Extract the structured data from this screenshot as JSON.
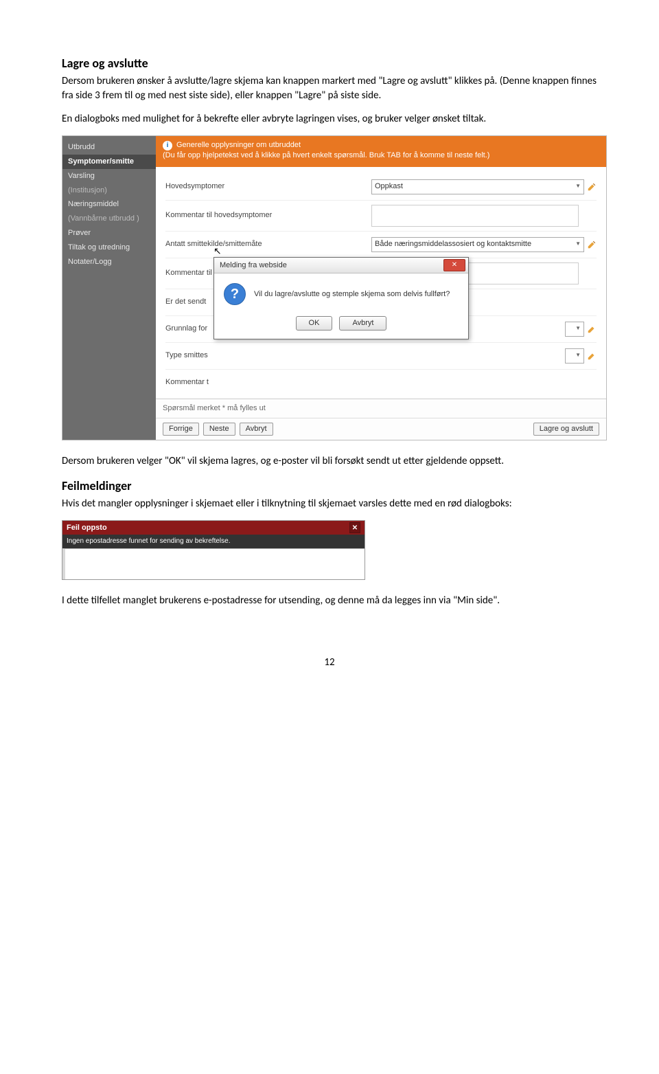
{
  "doc": {
    "h1": "Lagre og avslutte",
    "p1": "Dersom brukeren ønsker å avslutte/lagre skjema kan knappen markert med \"Lagre og avslutt\" klikkes på. (Denne knappen finnes fra side 3 frem til og med nest siste side), eller knappen \"Lagre\" på siste side.",
    "p2": "En dialogboks med mulighet for å bekrefte eller avbryte lagringen vises, og bruker velger ønsket tiltak.",
    "p3": "Dersom brukeren velger \"OK\" vil skjema lagres, og e-poster vil bli forsøkt sendt ut etter gjeldende oppsett.",
    "h2": "Feilmeldinger",
    "p4": "Hvis det mangler opplysninger i skjemaet eller i tilknytning til skjemaet varsles dette med en rød dialogboks:",
    "p5": "I dette tilfellet manglet brukerens e-postadresse for utsending, og denne må da legges inn via \"Min side\".",
    "pagenum": "12"
  },
  "ui": {
    "sidebar": {
      "items": [
        {
          "label": "Utbrudd"
        },
        {
          "label": "Symptomer/smitte",
          "sel": true
        },
        {
          "label": "Varsling"
        },
        {
          "label": "(Institusjon)",
          "dim": true
        },
        {
          "label": "Næringsmiddel"
        },
        {
          "label": "(Vannbårne utbrudd )",
          "dim": true
        },
        {
          "label": "Prøver"
        },
        {
          "label": "Tiltak og utredning"
        },
        {
          "label": "Notater/Logg"
        }
      ]
    },
    "banner": {
      "title": "Generelle opplysninger om utbruddet",
      "sub": "(Du får opp hjelpetekst ved å klikke på hvert enkelt spørsmål. Bruk TAB for å komme til neste felt.)"
    },
    "form": {
      "r1_label": "Hovedsymptomer",
      "r1_value": "Oppkast",
      "r2_label": "Kommentar til hovedsymptomer",
      "r3_label": "Antatt smittekilde/smittemåte",
      "r3_value": "Både næringsmiddelassosiert og kontaktsmitte",
      "r4_label": "Kommentar til smittekilde/smittemåte",
      "r5_label": "Er det sendt",
      "r6_label": "Grunnlag for",
      "r7_label": "Type smittes",
      "r8_label": "Kommentar t"
    },
    "footer": {
      "req": "Spørsmål merket * må fylles ut",
      "b1": "Forrige",
      "b2": "Neste",
      "b3": "Avbryt",
      "b4": "Lagre og avslutt"
    },
    "dialog": {
      "title": "Melding fra webside",
      "msg": "Vil du lagre/avslutte og stemple skjema som delvis fullført?",
      "ok": "OK",
      "cancel": "Avbryt"
    }
  },
  "err": {
    "title": "Feil oppsto",
    "msg": "Ingen epostadresse funnet for sending av bekreftelse."
  }
}
